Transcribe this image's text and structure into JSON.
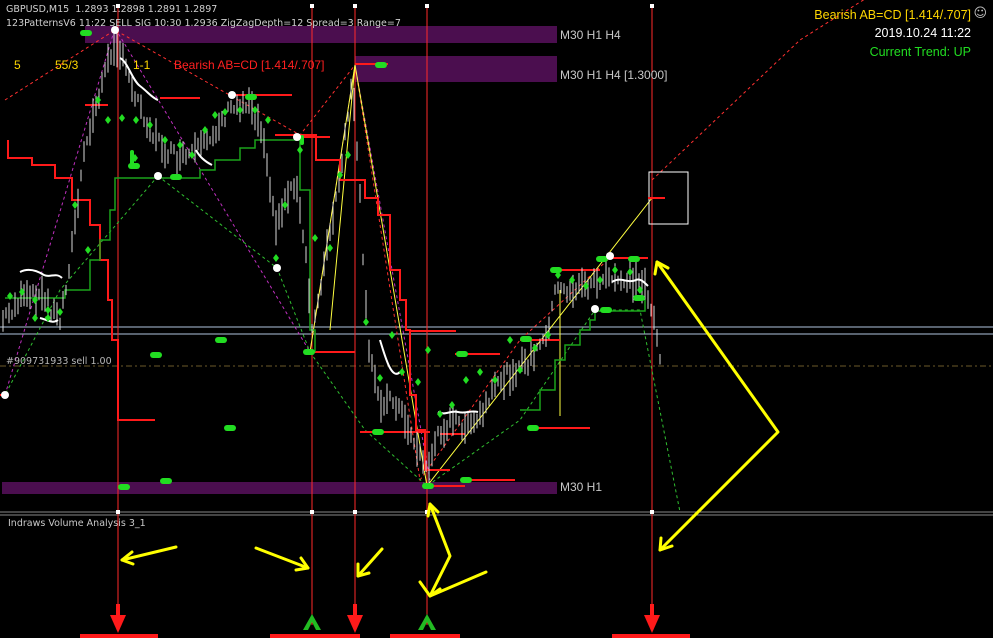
{
  "header": {
    "symbol": "GBPUSD,M15",
    "ohlc": "1.2893 1.2898 1.2891 1.2897",
    "indicator_line": "123PatternsV6  11:22  SELL SIG  10:30  1.2936  ZigZagDepth=12  Spread=3  Range=7"
  },
  "pattern_counts": {
    "c1": "5",
    "c2": "55/3",
    "c3": "1-1"
  },
  "pattern_label": "Bearish AB=CD [1.414/.707]",
  "right_panel": {
    "pattern": "Bearish AB=CD [1.414/.707]",
    "datetime": "2019.10.24 11:22",
    "trend": "Current Trend: UP",
    "colors": {
      "pattern": "#ffd700",
      "datetime": "#ffffff",
      "trend": "#22dd22"
    }
  },
  "zones": {
    "z1": "M30 H1 H4",
    "z2": "M30 H1 H4  [1.3000]",
    "z3": "M30 H1"
  },
  "order_line": "#909731933 sell 1.00",
  "subwindow": {
    "title": "Indraws Volume Analysis 3_1"
  },
  "icons": {
    "terminal_icon": "smiley-icon",
    "signal_down": "red-down-arrow-icon",
    "signal_up": "green-up-arrow-icon"
  }
}
